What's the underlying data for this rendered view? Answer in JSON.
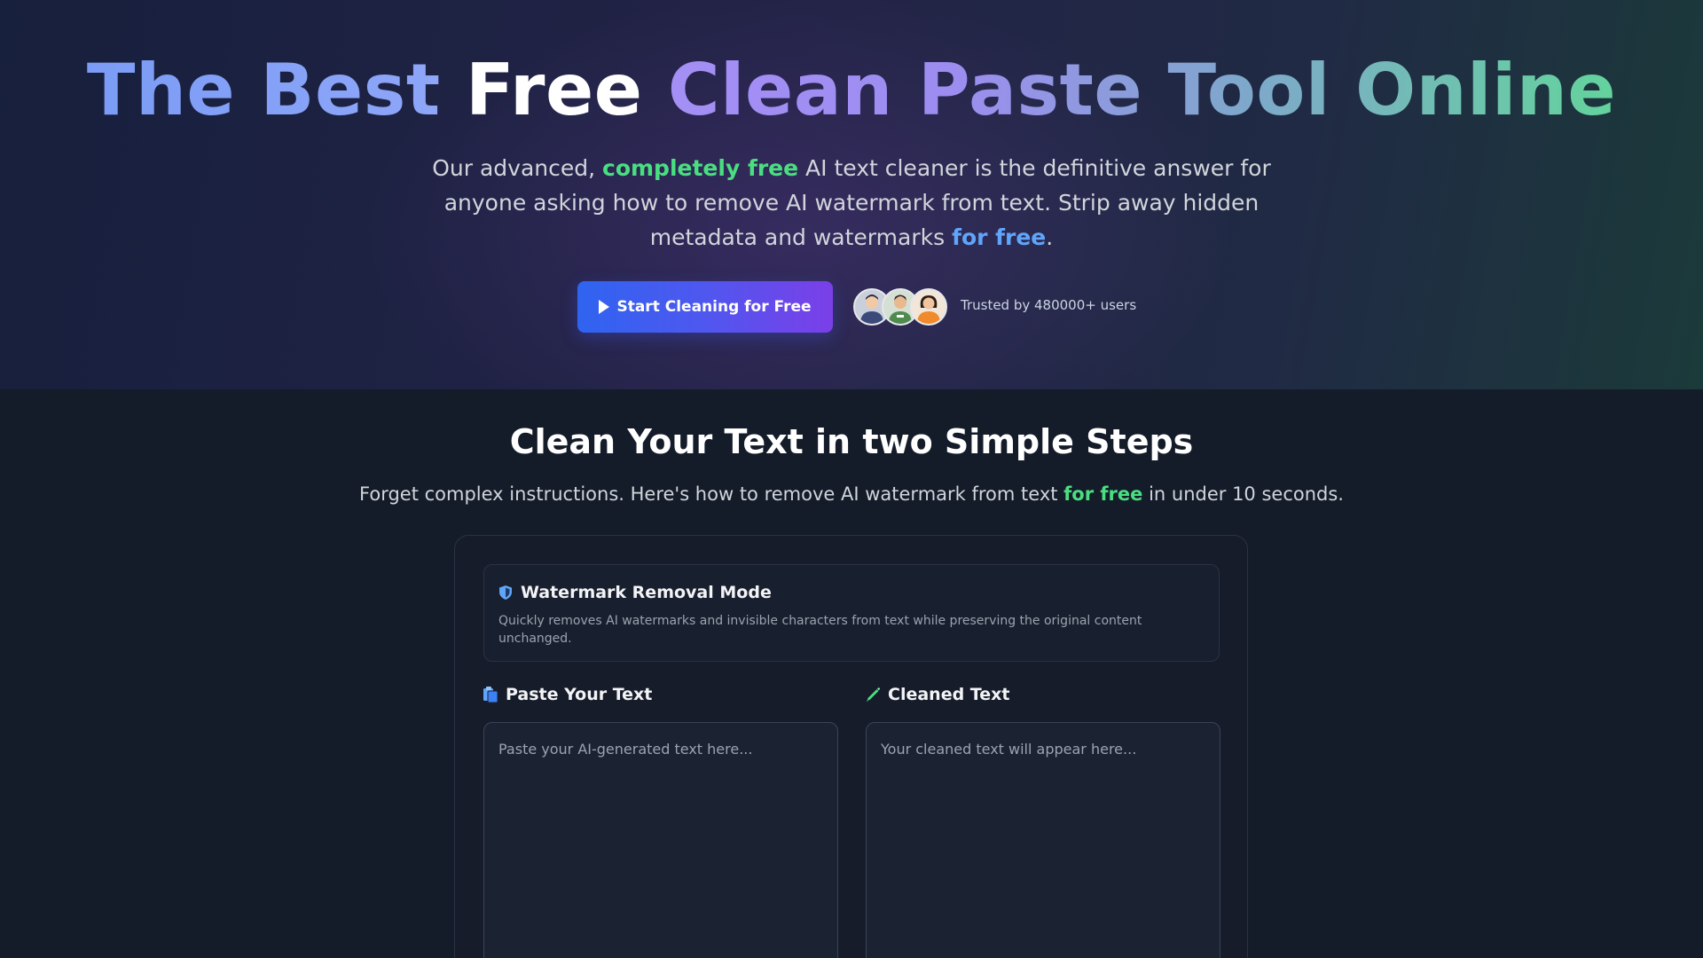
{
  "hero": {
    "title_part1": "The Best",
    "title_free": "Free",
    "title_part2": "Clean Paste Tool Online",
    "subtitle_1": "Our advanced,",
    "subtitle_hl1": "completely free",
    "subtitle_2": "AI text cleaner is the definitive answer for anyone asking how to remove AI watermark from text. Strip away hidden metadata and watermarks",
    "subtitle_hl2": "for free",
    "subtitle_3": ".",
    "cta_label": "Start Cleaning for Free",
    "cta_icon": "play-icon",
    "trusted_text": "Trusted by 480000+ users"
  },
  "steps": {
    "title": "Clean Your Text in two Simple Steps",
    "sub_1": "Forget complex instructions. Here's how to remove AI watermark from text",
    "sub_hl": "for free",
    "sub_2": "in under 10 seconds."
  },
  "mode": {
    "icon": "shield-icon",
    "title": "Watermark Removal Mode",
    "description": "Quickly removes AI watermarks and invisible characters from text while preserving the original content unchanged."
  },
  "input": {
    "icon": "clipboard-icon",
    "label": "Paste Your Text",
    "placeholder": "Paste your AI-generated text here...",
    "value": ""
  },
  "output": {
    "icon": "pencil-icon",
    "label": "Cleaned Text",
    "placeholder": "Your cleaned text will appear here...",
    "value": ""
  },
  "colors": {
    "accent_green": "#4ade80",
    "accent_blue": "#60a5fa",
    "cta_start": "#2f64f0",
    "cta_end": "#7b3fe8"
  }
}
